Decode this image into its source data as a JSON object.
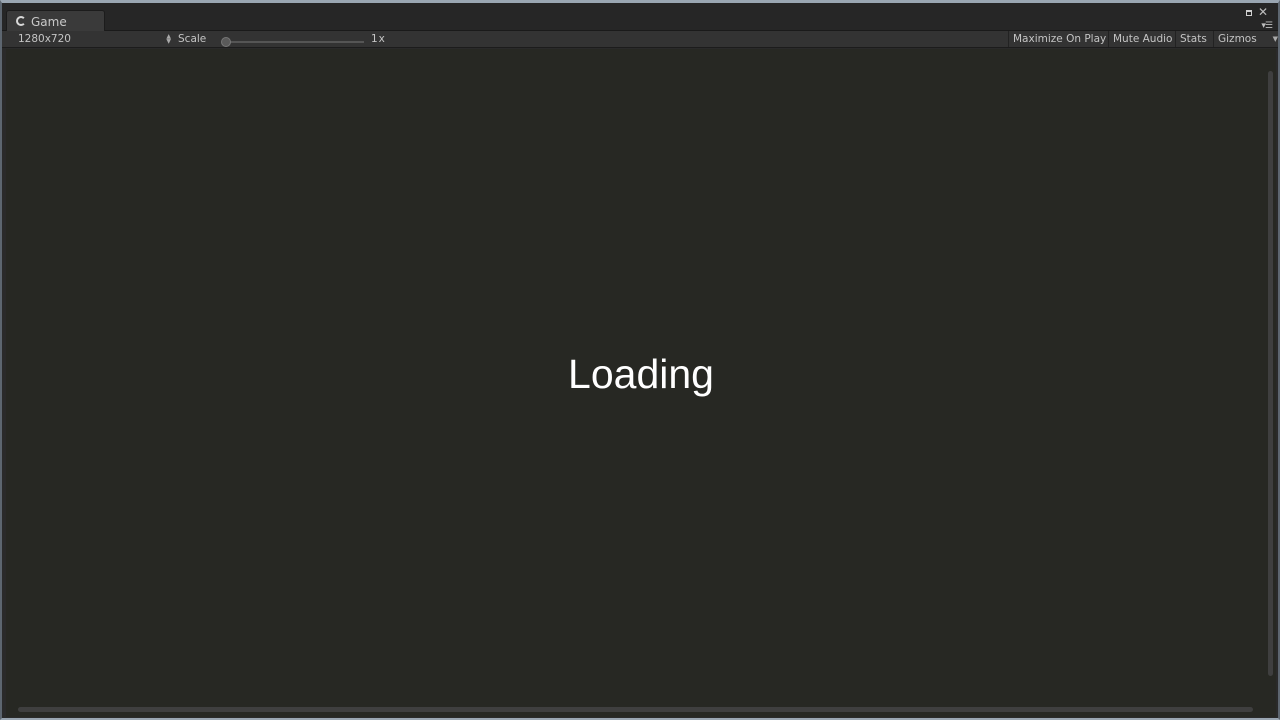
{
  "tab": {
    "label": "Game",
    "icon": "unity-pacman-icon"
  },
  "window_controls": {
    "maximize": "maximize-icon",
    "close": "close-icon",
    "menu": "menu-icon"
  },
  "toolbar": {
    "resolution": "1280x720",
    "scale_label": "Scale",
    "scale_value": "1x",
    "scale_fraction": 0.0,
    "maximize_on_play": "Maximize On Play",
    "mute_audio": "Mute Audio",
    "stats": "Stats",
    "gizmos": "Gizmos"
  },
  "game_view": {
    "status_text": "Loading",
    "background": "#272823",
    "text_color": "#ffffff"
  }
}
